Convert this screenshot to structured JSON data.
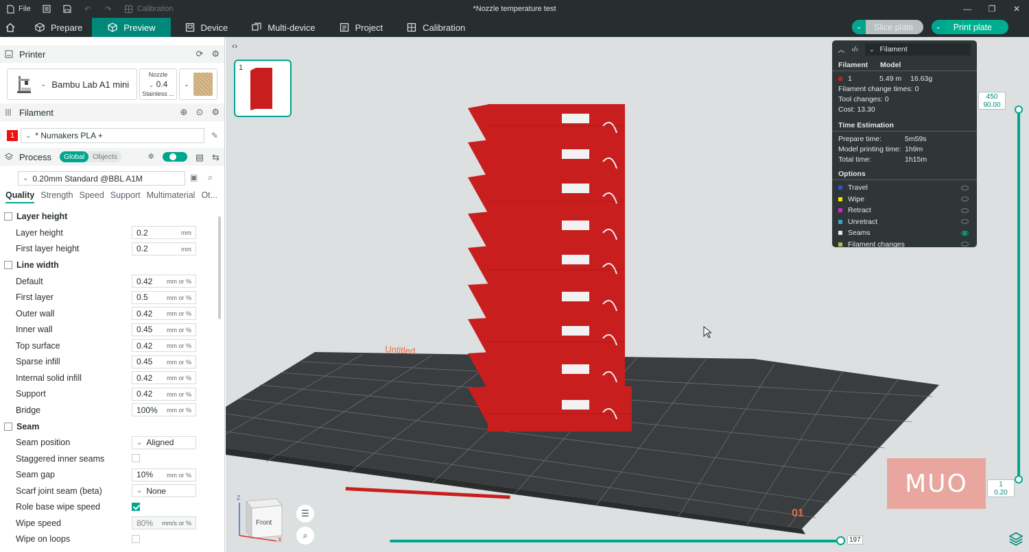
{
  "titlebar": {
    "file_label": "File",
    "calibration_label": "Calibration",
    "window_title": "*Nozzle temperature test"
  },
  "tabs": [
    {
      "label": "Prepare",
      "icon": "cube-icon"
    },
    {
      "label": "Preview",
      "icon": "cube-icon",
      "active": true
    },
    {
      "label": "Device",
      "icon": "device-icon"
    },
    {
      "label": "Multi-device",
      "icon": "multi-device-icon"
    },
    {
      "label": "Project",
      "icon": "project-icon"
    },
    {
      "label": "Calibration",
      "icon": "calibration-icon"
    }
  ],
  "actions": {
    "slice_label": "Slice plate",
    "print_label": "Print plate"
  },
  "printer": {
    "header": "Printer",
    "name": "Bambu Lab A1 mini",
    "nozzle_label": "Nozzle",
    "nozzle_value": "0.4",
    "nozzle_type": "Stainless ..."
  },
  "filament": {
    "header": "Filament",
    "slot": "1",
    "name": "* Numakers PLA +"
  },
  "process": {
    "header": "Process",
    "seg_global": "Global",
    "seg_objects": "Objects",
    "preset": "0.20mm Standard @BBL A1M",
    "subtabs": [
      "Quality",
      "Strength",
      "Speed",
      "Support",
      "Multimaterial",
      "Ot..."
    ]
  },
  "groups": {
    "layer_height": "Layer height",
    "line_width": "Line width",
    "seam": "Seam"
  },
  "params": {
    "layer_height": {
      "label": "Layer height",
      "value": "0.2",
      "unit": "mm"
    },
    "first_layer_height": {
      "label": "First layer height",
      "value": "0.2",
      "unit": "mm"
    },
    "lw_default": {
      "label": "Default",
      "value": "0.42",
      "unit": "mm or %"
    },
    "lw_first_layer": {
      "label": "First layer",
      "value": "0.5",
      "unit": "mm or %"
    },
    "lw_outer_wall": {
      "label": "Outer wall",
      "value": "0.42",
      "unit": "mm or %"
    },
    "lw_inner_wall": {
      "label": "Inner wall",
      "value": "0.45",
      "unit": "mm or %"
    },
    "lw_top_surface": {
      "label": "Top surface",
      "value": "0.42",
      "unit": "mm or %"
    },
    "lw_sparse_infill": {
      "label": "Sparse infill",
      "value": "0.45",
      "unit": "mm or %"
    },
    "lw_internal_solid": {
      "label": "Internal solid infill",
      "value": "0.42",
      "unit": "mm or %"
    },
    "lw_support": {
      "label": "Support",
      "value": "0.42",
      "unit": "mm or %"
    },
    "lw_bridge": {
      "label": "Bridge",
      "value": "100%",
      "unit": "mm or %"
    },
    "seam_position": {
      "label": "Seam position",
      "value": "Aligned"
    },
    "staggered_inner": {
      "label": "Staggered inner seams"
    },
    "seam_gap": {
      "label": "Seam gap",
      "value": "10%",
      "unit": "mm or %"
    },
    "scarf_joint": {
      "label": "Scarf joint seam (beta)",
      "value": "None"
    },
    "role_wipe_speed": {
      "label": "Role base wipe speed"
    },
    "wipe_speed": {
      "label": "Wipe speed",
      "value": "80%",
      "unit": "mm/s or %"
    },
    "wipe_on_loops": {
      "label": "Wipe on loops"
    }
  },
  "viewport": {
    "plate_number": "1",
    "plate_name": "Untitled",
    "plate_index": "01",
    "cube_face": "Front",
    "axis_z": "Z",
    "axis_x": "X"
  },
  "legend": {
    "view_type": "Filament",
    "col_filament": "Filament",
    "col_model": "Model",
    "row_slot": "1",
    "row_length": "5.49 m",
    "row_weight": "16.63g",
    "change_times_label": "Filament change times:",
    "change_times_value": "0",
    "tool_changes_label": "Tool changes:",
    "tool_changes_value": "0",
    "cost_label": "Cost:",
    "cost_value": "13.30",
    "time_header": "Time Estimation",
    "prepare_label": "Prepare time:",
    "prepare_value": "5m59s",
    "model_label": "Model printing time:",
    "model_value": "1h9m",
    "total_label": "Total time:",
    "total_value": "1h15m",
    "options_header": "Options",
    "options": [
      {
        "label": "Travel",
        "color": "#3a4fd8",
        "visible": false
      },
      {
        "label": "Wipe",
        "color": "#f2e600",
        "visible": false
      },
      {
        "label": "Retract",
        "color": "#d41fd4",
        "visible": false
      },
      {
        "label": "Unretract",
        "color": "#3aa3d6",
        "visible": false
      },
      {
        "label": "Seams",
        "color": "#e6e6e6",
        "visible": true
      },
      {
        "label": "Filament changes",
        "color": "#b9b94a",
        "visible": false
      }
    ]
  },
  "sliders": {
    "layer_top_value": "450",
    "layer_top_height": "90.00",
    "layer_bottom_value": "1",
    "layer_bottom_height": "0.20",
    "move_value": "197"
  },
  "watermark": "MUO",
  "colors": {
    "accent": "#00a58e",
    "filament": "#c81e1e"
  }
}
